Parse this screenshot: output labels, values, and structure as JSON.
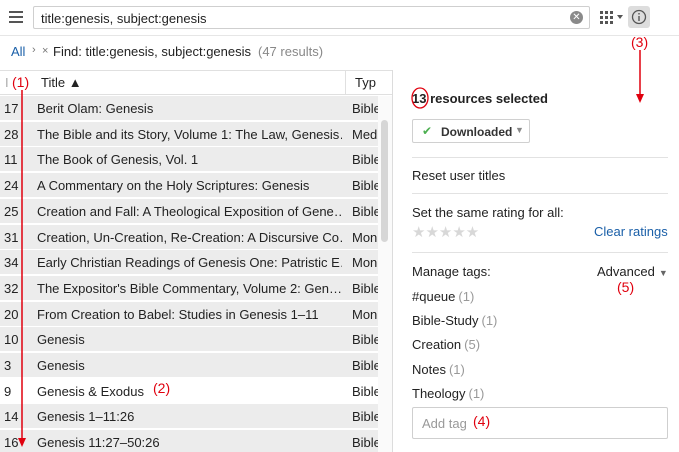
{
  "toolbar": {
    "search_value": "title:genesis, subject:genesis",
    "clear_icon": "clear-icon",
    "view_icon": "list-view-icon",
    "info_icon": "info-icon"
  },
  "breadcrumb": {
    "all": "All",
    "separator": "›",
    "remove": "×",
    "find": "Find: title:genesis, subject:genesis",
    "count": "(47 results)"
  },
  "table": {
    "col_num": "I",
    "col_title": "Title ▲",
    "col_type": "Typ",
    "rows": [
      {
        "num": "17",
        "title": "Berit Olam: Genesis",
        "type": "Bible"
      },
      {
        "num": "28",
        "title": "The Bible and its Story, Volume 1: The Law, Genesis…",
        "type": "Med"
      },
      {
        "num": "11",
        "title": "The Book of Genesis, Vol. 1",
        "type": "Bible"
      },
      {
        "num": "24",
        "title": "A Commentary on the Holy Scriptures: Genesis",
        "type": "Bible"
      },
      {
        "num": "25",
        "title": "Creation and Fall: A Theological Exposition of Gene…",
        "type": "Bible"
      },
      {
        "num": "31",
        "title": "Creation, Un-Creation, Re-Creation: A Discursive Co…",
        "type": "Mon"
      },
      {
        "num": "34",
        "title": "Early Christian Readings of Genesis One: Patristic E…",
        "type": "Mon"
      },
      {
        "num": "32",
        "title": "The Expositor's Bible Commentary, Volume 2: Gen…",
        "type": "Bible"
      },
      {
        "num": "20",
        "title": "From Creation to Babel: Studies in Genesis 1–11",
        "type": "Mon"
      },
      {
        "num": "10",
        "title": "Genesis",
        "type": "Bible"
      },
      {
        "num": "3",
        "title": "Genesis",
        "type": "Bible"
      },
      {
        "num": "9",
        "title": "Genesis & Exodus",
        "type": "Bible"
      },
      {
        "num": "14",
        "title": "Genesis 1–11:26",
        "type": "Bible"
      },
      {
        "num": "16",
        "title": "Genesis 11:27–50:26",
        "type": "Bible"
      }
    ]
  },
  "panel": {
    "selected_count": "13",
    "selected_text": "resources selected",
    "downloaded": "Downloaded",
    "reset_titles": "Reset user titles",
    "rating_label": "Set the same rating for all:",
    "stars": "★★★★★",
    "clear_ratings": "Clear ratings",
    "manage_tags": "Manage tags:",
    "advanced": "Advanced",
    "tags": [
      {
        "name": "#queue",
        "count": "(1)"
      },
      {
        "name": "Bible-Study",
        "count": "(1)"
      },
      {
        "name": "Creation",
        "count": "(5)"
      },
      {
        "name": "Notes",
        "count": "(1)"
      },
      {
        "name": "Theology",
        "count": "(1)"
      }
    ],
    "add_tag_placeholder": "Add tag"
  },
  "annotations": {
    "a1": "(1)",
    "a2": "(2)",
    "a3": "(3)",
    "a4": "(4)",
    "a5": "(5)",
    "color": "#e0000e"
  }
}
